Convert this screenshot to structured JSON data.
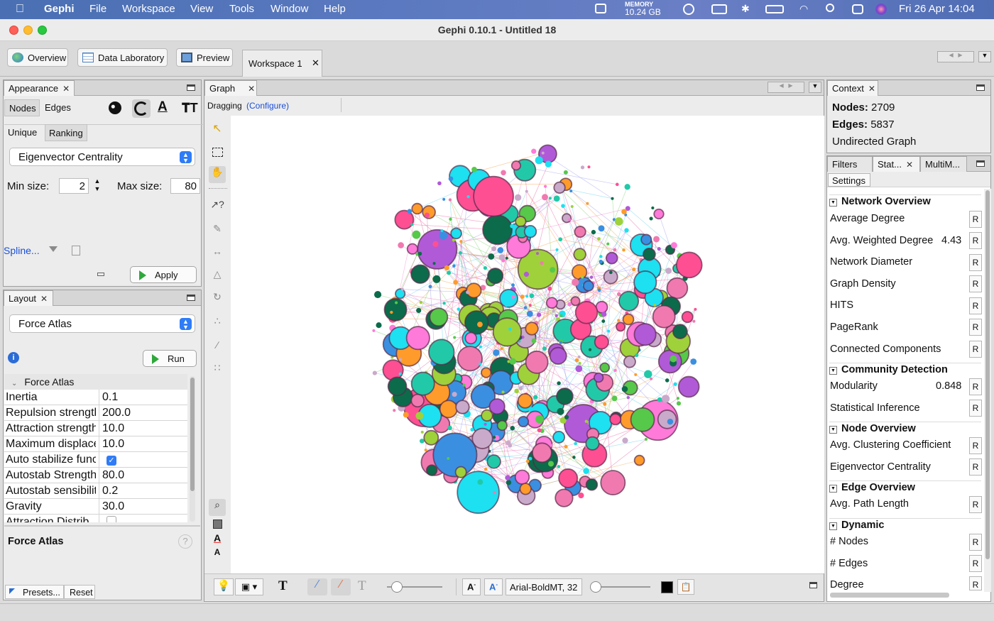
{
  "menubar": {
    "app": "Gephi",
    "items": [
      "File",
      "Workspace",
      "View",
      "Tools",
      "Window",
      "Help"
    ],
    "memory_label": "MEMORY",
    "memory_value": "10.24 GB",
    "datetime": "Fri 26 Apr  14:04"
  },
  "window": {
    "title": "Gephi 0.10.1 - Untitled 18"
  },
  "toolbar": {
    "overview": "Overview",
    "data_lab": "Data Laboratory",
    "preview": "Preview",
    "workspace_tab": "Workspace 1"
  },
  "appearance": {
    "tab": "Appearance",
    "nodes": "Nodes",
    "edges": "Edges",
    "unique": "Unique",
    "ranking": "Ranking",
    "attribute": "Eigenvector Centrality",
    "min_label": "Min size:",
    "min_value": "2",
    "max_label": "Max size:",
    "max_value": "80",
    "spline": "Spline...",
    "apply": "Apply"
  },
  "layout": {
    "tab": "Layout",
    "algorithm": "Force Atlas",
    "run": "Run",
    "section": "Force Atlas",
    "props": [
      {
        "k": "Inertia",
        "v": "0.1"
      },
      {
        "k": "Repulsion strength",
        "v": "200.0"
      },
      {
        "k": "Attraction strength",
        "v": "10.0"
      },
      {
        "k": "Maximum displacement",
        "v": "10.0"
      },
      {
        "k": "Auto stabilize function",
        "v": ""
      },
      {
        "k": "Autostab Strength",
        "v": "80.0"
      },
      {
        "k": "Autostab sensibility",
        "v": "0.2"
      },
      {
        "k": "Gravity",
        "v": "30.0"
      },
      {
        "k": "Attraction Distrib.",
        "v": ""
      }
    ],
    "auto_stabilize_checked": true,
    "footer_title": "Force Atlas",
    "presets": "Presets...",
    "reset": "Reset"
  },
  "graph": {
    "tab": "Graph",
    "mode": "Dragging",
    "configure": "(Configure)",
    "font": "Arial-BoldMT, 32"
  },
  "context": {
    "tab": "Context",
    "nodes_label": "Nodes:",
    "nodes": "2709",
    "edges_label": "Edges:",
    "edges": "5837",
    "type": "Undirected Graph"
  },
  "stats": {
    "tabs": [
      "Filters",
      "Stat...",
      "MultiM..."
    ],
    "settings": "Settings",
    "sections": [
      {
        "title": "Network Overview",
        "items": [
          {
            "n": "Average Degree",
            "v": ""
          },
          {
            "n": "Avg. Weighted Degree",
            "v": "4.43"
          },
          {
            "n": "Network Diameter",
            "v": ""
          },
          {
            "n": "Graph Density",
            "v": ""
          },
          {
            "n": "HITS",
            "v": ""
          },
          {
            "n": "PageRank",
            "v": ""
          },
          {
            "n": "Connected Components",
            "v": ""
          }
        ]
      },
      {
        "title": "Community Detection",
        "items": [
          {
            "n": "Modularity",
            "v": "0.848"
          },
          {
            "n": "Statistical Inference",
            "v": ""
          }
        ]
      },
      {
        "title": "Node Overview",
        "items": [
          {
            "n": "Avg. Clustering Coefficient",
            "v": ""
          },
          {
            "n": "Eigenvector Centrality",
            "v": ""
          }
        ]
      },
      {
        "title": "Edge Overview",
        "items": [
          {
            "n": "Avg. Path Length",
            "v": ""
          }
        ]
      },
      {
        "title": "Dynamic",
        "items": [
          {
            "n": "# Nodes",
            "v": ""
          },
          {
            "n": "# Edges",
            "v": ""
          },
          {
            "n": "Degree",
            "v": ""
          }
        ]
      }
    ],
    "run_label": "R"
  }
}
